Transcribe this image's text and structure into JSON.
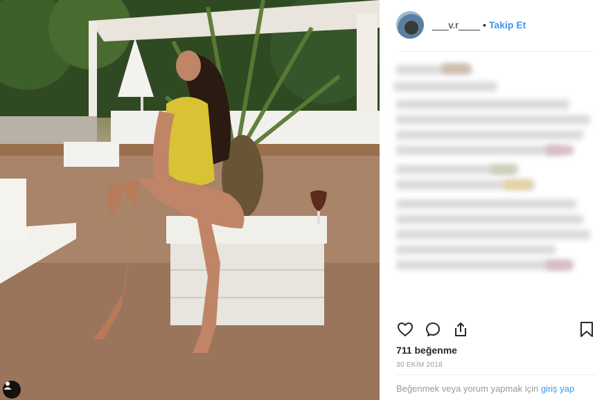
{
  "header": {
    "username": "___v.r____",
    "separator": "•",
    "follow_label": "Takip Et"
  },
  "post": {
    "likes_text": "711 beğenme",
    "date_text": "30 EKİM 2018"
  },
  "footer": {
    "login_prompt": "Beğenmek veya yorum yapmak için",
    "login_link": "giriş yap"
  },
  "icons": {
    "like": "heart-icon",
    "comment": "comment-icon",
    "share": "share-icon",
    "save": "bookmark-icon",
    "user_tags": "user-icon"
  },
  "colors": {
    "link_blue": "#3897f0",
    "text_dark": "#262626",
    "text_muted": "#999999",
    "divider": "#efefef"
  }
}
